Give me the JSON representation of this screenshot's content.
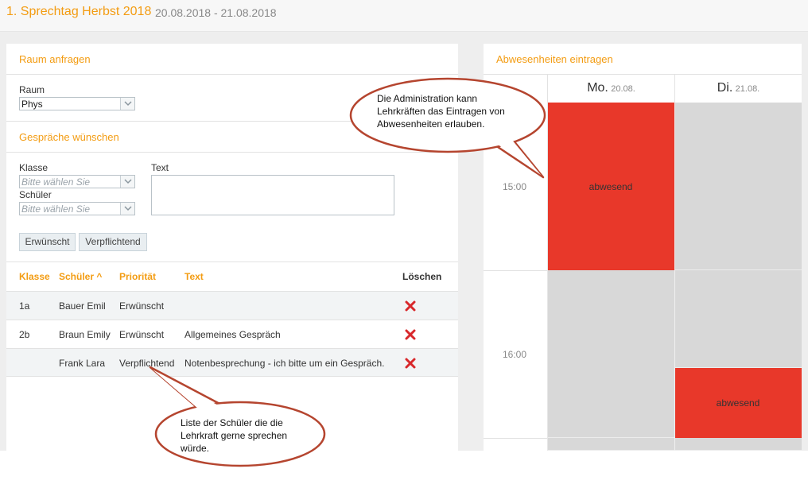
{
  "header": {
    "title": "1. Sprechtag Herbst 2018",
    "dates": "20.08.2018 - 21.08.2018"
  },
  "room_request": {
    "title": "Raum anfragen",
    "room_label": "Raum",
    "room_value": "Phys"
  },
  "talk_requests": {
    "title": "Gespräche wünschen",
    "class_label": "Klasse",
    "class_placeholder": "Bitte wählen Sie",
    "student_label": "Schüler",
    "student_placeholder": "Bitte wählen Sie",
    "text_label": "Text",
    "btn_desired": "Erwünscht",
    "btn_mandatory": "Verpflichtend"
  },
  "table": {
    "headers": {
      "klasse": "Klasse",
      "schueler": "Schüler ^",
      "prioritaet": "Priorität",
      "text": "Text",
      "loeschen": "Löschen"
    },
    "rows": [
      {
        "klasse": "1a",
        "schueler": "Bauer Emil",
        "prioritaet": "Erwünscht",
        "text": ""
      },
      {
        "klasse": "2b",
        "schueler": "Braun Emily",
        "prioritaet": "Erwünscht",
        "text": "Allgemeines Gespräch"
      },
      {
        "klasse": "",
        "schueler": "Frank Lara",
        "prioritaet": "Verpflichtend",
        "text": "Notenbesprechung - ich bitte um ein Gespräch."
      }
    ]
  },
  "absences": {
    "title": "Abwesenheiten eintragen",
    "days": [
      {
        "name": "Mo.",
        "date": "20.08."
      },
      {
        "name": "Di.",
        "date": "21.08."
      }
    ],
    "times": [
      "15:00",
      "16:00"
    ],
    "absent_label_mo": "abwesend",
    "absent_label_di": "abwesend"
  },
  "callouts": {
    "admin": [
      "Die Administration kann",
      "Lehrkräften das Eintragen von",
      "Abwesenheiten erlauben."
    ],
    "list": [
      "Liste der Schüler die die",
      "Lehrkraft gerne sprechen",
      "würde."
    ]
  },
  "colors": {
    "accent": "#f39c12",
    "absent": "#e8382a",
    "callout_border": "#b5452f"
  }
}
